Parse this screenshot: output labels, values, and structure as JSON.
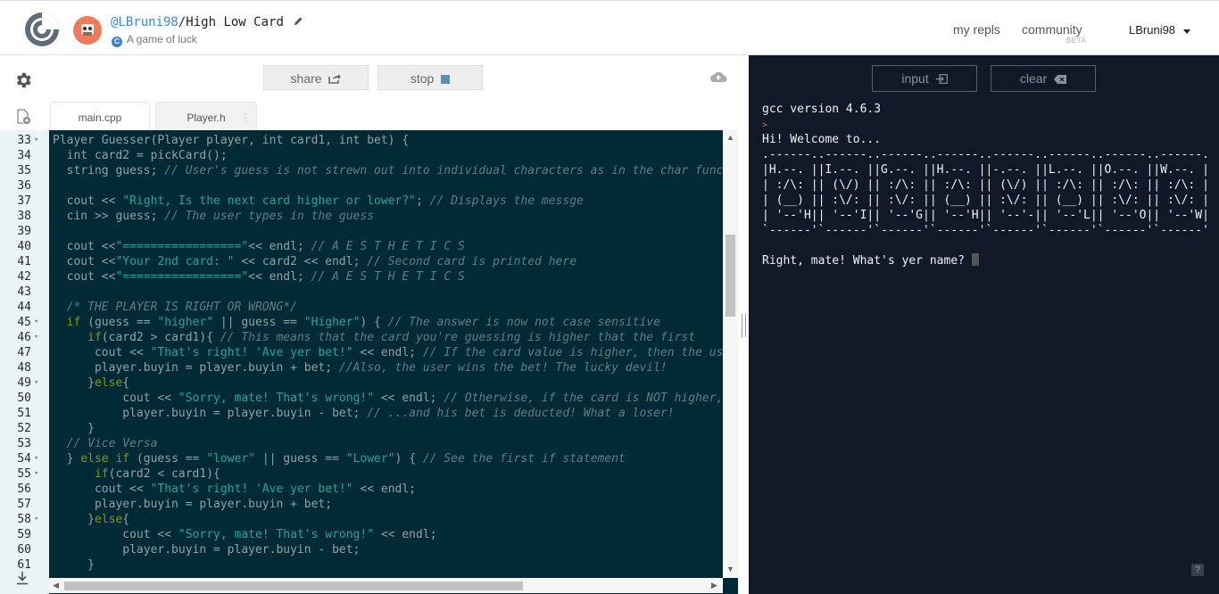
{
  "header": {
    "owner": "@LBruni98",
    "separator": "/",
    "repl_name": "High Low Card",
    "description": "A game of luck",
    "nav": {
      "my_repls": "my repls",
      "community": "community",
      "beta": "BETA"
    },
    "username": "LBruni98"
  },
  "toolbar": {
    "share_label": "share",
    "stop_label": "stop"
  },
  "tabs": [
    {
      "label": "main.cpp"
    },
    {
      "label": "Player.h"
    }
  ],
  "editor": {
    "lines": [
      {
        "n": "33",
        "fold": true,
        "segs": [
          [
            "Player Guesser(Player player, int card1, int bet) {",
            "op"
          ]
        ]
      },
      {
        "n": "34",
        "segs": [
          [
            "  int card2 = pickCard();",
            "op"
          ]
        ]
      },
      {
        "n": "35",
        "segs": [
          [
            "  string guess; ",
            "op"
          ],
          [
            "// User's guess is not strewn out into individual characters as in the char functi",
            "cm"
          ]
        ]
      },
      {
        "n": "36",
        "segs": []
      },
      {
        "n": "37",
        "segs": [
          [
            "  cout << ",
            "op"
          ],
          [
            "\"Right, Is the next card higher or lower?\"",
            "str"
          ],
          [
            "; ",
            "op"
          ],
          [
            "// Displays the messge",
            "cm"
          ]
        ]
      },
      {
        "n": "38",
        "segs": [
          [
            "  cin >> guess; ",
            "op"
          ],
          [
            "// The user types in the guess",
            "cm"
          ]
        ]
      },
      {
        "n": "39",
        "segs": []
      },
      {
        "n": "40",
        "segs": [
          [
            "  cout <<",
            "op"
          ],
          [
            "\"=================\"",
            "str"
          ],
          [
            "<< endl; ",
            "op"
          ],
          [
            "// A E S T H E T I C S",
            "cm"
          ]
        ]
      },
      {
        "n": "41",
        "segs": [
          [
            "  cout <<",
            "op"
          ],
          [
            "\"Your 2nd card: \"",
            "str"
          ],
          [
            " << card2 << endl; ",
            "op"
          ],
          [
            "// Second card is printed here",
            "cm"
          ]
        ]
      },
      {
        "n": "42",
        "segs": [
          [
            "  cout <<",
            "op"
          ],
          [
            "\"=================\"",
            "str"
          ],
          [
            "<< endl; ",
            "op"
          ],
          [
            "// A E S T H E T I C S",
            "cm"
          ]
        ]
      },
      {
        "n": "43",
        "segs": []
      },
      {
        "n": "44",
        "segs": [
          [
            "  /* THE PLAYER IS RIGHT OR WRONG*/",
            "cm"
          ]
        ]
      },
      {
        "n": "45",
        "fold": true,
        "segs": [
          [
            "  ",
            "op"
          ],
          [
            "if",
            "kw"
          ],
          [
            " (guess == ",
            "op"
          ],
          [
            "\"higher\"",
            "str"
          ],
          [
            " || guess == ",
            "op"
          ],
          [
            "\"Higher\"",
            "str"
          ],
          [
            ") { ",
            "op"
          ],
          [
            "// The answer is now not case sensitive",
            "cm"
          ]
        ]
      },
      {
        "n": "46",
        "fold": true,
        "segs": [
          [
            "     ",
            "op"
          ],
          [
            "if",
            "kw"
          ],
          [
            "(card2 > card1){ ",
            "op"
          ],
          [
            "// This means that the card you're guessing is higher that the first",
            "cm"
          ]
        ]
      },
      {
        "n": "47",
        "segs": [
          [
            "      cout << ",
            "op"
          ],
          [
            "\"That's right! 'Ave yer bet!\"",
            "str"
          ],
          [
            " << endl; ",
            "op"
          ],
          [
            "// If the card value is higher, then the user",
            "cm"
          ]
        ]
      },
      {
        "n": "48",
        "segs": [
          [
            "      player.buyin = player.buyin + bet; ",
            "op"
          ],
          [
            "//Also, the user wins the bet! The lucky devil!",
            "cm"
          ]
        ]
      },
      {
        "n": "49",
        "fold": true,
        "segs": [
          [
            "     }",
            "op"
          ],
          [
            "else",
            "kw"
          ],
          [
            "{",
            "op"
          ]
        ]
      },
      {
        "n": "50",
        "segs": [
          [
            "          cout << ",
            "op"
          ],
          [
            "\"Sorry, mate! That's wrong!\"",
            "str"
          ],
          [
            " << endl; ",
            "op"
          ],
          [
            "// Otherwise, if the card is NOT higher, t",
            "cm"
          ]
        ]
      },
      {
        "n": "51",
        "segs": [
          [
            "          player.buyin = player.buyin - bet; ",
            "op"
          ],
          [
            "// ...and his bet is deducted! What a loser!",
            "cm"
          ]
        ]
      },
      {
        "n": "52",
        "segs": [
          [
            "     }",
            "op"
          ]
        ]
      },
      {
        "n": "53",
        "segs": [
          [
            "  // Vice Versa",
            "cm"
          ]
        ]
      },
      {
        "n": "54",
        "fold": true,
        "segs": [
          [
            "  } ",
            "op"
          ],
          [
            "else if",
            "kw"
          ],
          [
            " (guess == ",
            "op"
          ],
          [
            "\"lower\"",
            "str"
          ],
          [
            " || guess == ",
            "op"
          ],
          [
            "\"Lower\"",
            "str"
          ],
          [
            ") { ",
            "op"
          ],
          [
            "// See the first if statement",
            "cm"
          ]
        ]
      },
      {
        "n": "55",
        "fold": true,
        "segs": [
          [
            "      ",
            "op"
          ],
          [
            "if",
            "kw"
          ],
          [
            "(card2 < card1){",
            "op"
          ]
        ]
      },
      {
        "n": "56",
        "segs": [
          [
            "      cout << ",
            "op"
          ],
          [
            "\"That's right! 'Ave yer bet!\"",
            "str"
          ],
          [
            " << endl;",
            "op"
          ]
        ]
      },
      {
        "n": "57",
        "segs": [
          [
            "      player.buyin = player.buyin + bet;",
            "op"
          ]
        ]
      },
      {
        "n": "58",
        "fold": true,
        "segs": [
          [
            "     }",
            "op"
          ],
          [
            "else",
            "kw"
          ],
          [
            "{",
            "op"
          ]
        ]
      },
      {
        "n": "59",
        "segs": [
          [
            "          cout << ",
            "op"
          ],
          [
            "\"Sorry, mate! That's wrong!\"",
            "str"
          ],
          [
            " << endl;",
            "op"
          ]
        ]
      },
      {
        "n": "60",
        "segs": [
          [
            "          player.buyin = player.buyin - bet;",
            "op"
          ]
        ]
      },
      {
        "n": "61",
        "segs": [
          [
            "     }",
            "op"
          ]
        ]
      }
    ]
  },
  "console": {
    "input_label": "input",
    "clear_label": "clear",
    "version": "gcc version 4.6.3",
    "prompt_symbol": ">",
    "welcome": "Hi! Welcome to...",
    "ascii_art": [
      ".------..------..------..------..------..------..------..------.",
      "|H.--. ||I.--. ||G.--. ||H.--. ||-.--. ||L.--. ||O.--. ||W.--. |",
      "| :/\\: || (\\/) || :/\\: || :/\\: || (\\/) || :/\\: || :/\\: || :/\\: |",
      "| (__) || :\\/: || :\\/: || (__) || :\\/: || (__) || :\\/: || :\\/: |",
      "| '--'H|| '--'I|| '--'G|| '--'H|| '--'-|| '--'L|| '--'O|| '--'W|",
      "`------'`------'`------'`------'`------'`------'`------'`------'"
    ],
    "question": "Right, mate! What's yer name? ",
    "help": "?"
  }
}
